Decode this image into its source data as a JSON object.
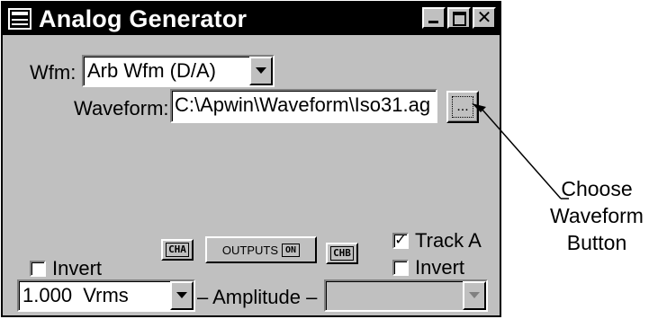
{
  "window": {
    "title": "Analog Generator"
  },
  "wfm": {
    "label": "Wfm:",
    "value": "Arb Wfm (D/A)"
  },
  "waveform": {
    "label": "Waveform:",
    "path": "C:\\Apwin\\Waveform\\Iso31.ag",
    "browse_label": "..."
  },
  "controls": {
    "invert_a_label": "Invert",
    "invert_a_checked": false,
    "cha_label": "CHA",
    "outputs_label": "OUTPUTS",
    "outputs_state": "ON",
    "chb_label": "CHB",
    "track_a_label": "Track A",
    "track_a_checked": true,
    "invert_b_label": "Invert",
    "invert_b_checked": false
  },
  "amplitude": {
    "value": "1.000  Vrms",
    "label": "– Amplitude –",
    "chb_value": ""
  },
  "callout": {
    "line1": "Choose",
    "line2": "Waveform",
    "line3": "Button"
  }
}
